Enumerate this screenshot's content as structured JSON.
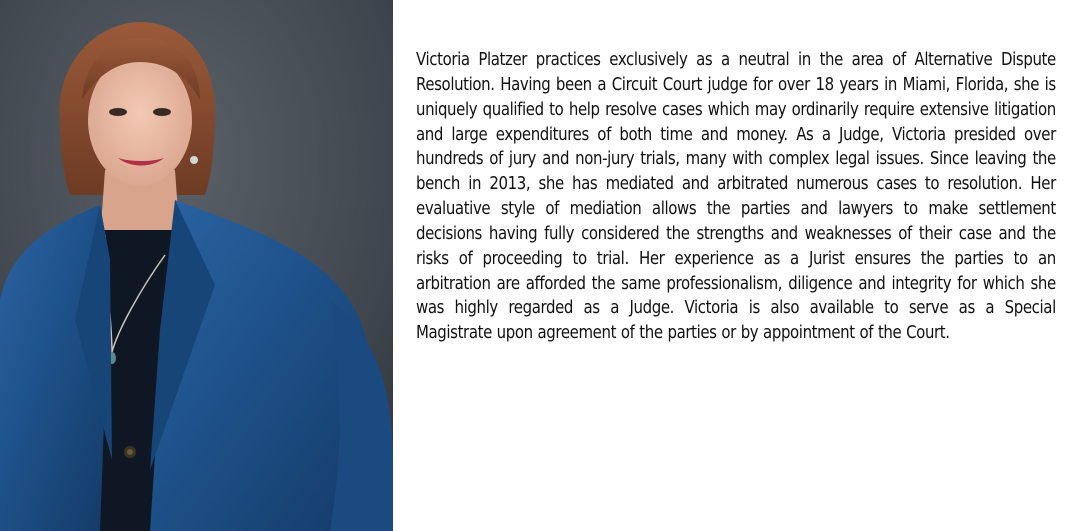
{
  "bio": {
    "text": "Victoria Platzer practices exclusively as a neutral in the area of Alternative Dispute Resolution. Having been a Circuit Court judge for over 18 years in Miami, Florida, she is uniquely qualified to help resolve cases which may ordinarily require extensive litigation and large expenditures of both time and money. As a Judge, Victoria presided over hundreds of jury and non-jury trials, many with complex legal issues. Since leaving the bench in 2013, she has mediated and arbitrated numerous cases to resolution. Her evaluative style of mediation allows the parties and lawyers to make settlement decisions having fully considered the strengths and weaknesses of their case and the risks of proceeding to trial. Her experience as a Jurist ensures the parties to an arbitration are afforded the same professionalism, diligence and integrity for which she was highly regarded as a Judge. Victoria is also available to serve as a Special Magistrate upon agreement of the parties or by appointment of the Court."
  },
  "colors": {
    "backdrop": "#3d434b",
    "blazer": "#1d4f86",
    "text": "#111111"
  }
}
